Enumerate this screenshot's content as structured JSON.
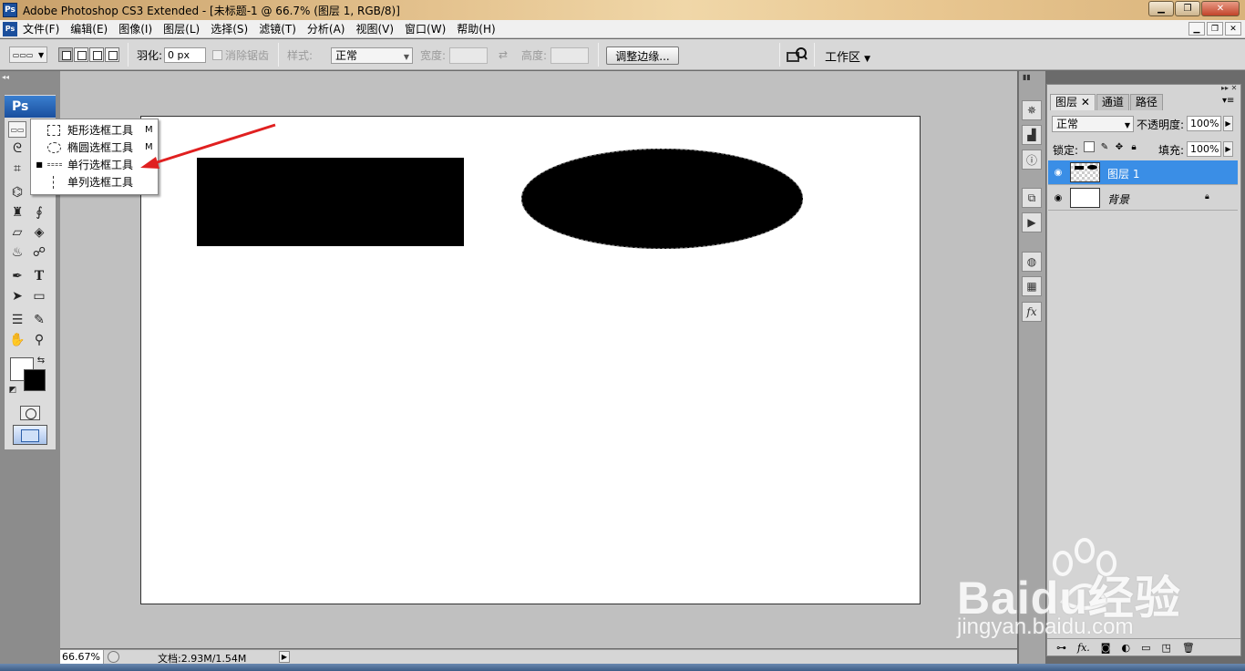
{
  "window": {
    "title": "Adobe Photoshop CS3 Extended - [未标题-1 @ 66.7% (图层 1, RGB/8)]",
    "app_icon": "Ps",
    "buttons": [
      "minimize-icon",
      "restore-icon",
      "close-icon"
    ]
  },
  "menubar": {
    "items": [
      "文件(F)",
      "编辑(E)",
      "图像(I)",
      "图层(L)",
      "选择(S)",
      "滤镜(T)",
      "分析(A)",
      "视图(V)",
      "窗口(W)",
      "帮助(H)"
    ]
  },
  "options": {
    "feather_label": "羽化:",
    "feather_value": "0 px",
    "antialias_label": "消除锯齿",
    "style_label": "样式:",
    "style_value": "正常",
    "width_label": "宽度:",
    "height_label": "高度:",
    "refine_edge": "调整边缘...",
    "workspace": "工作区"
  },
  "toolbox": {
    "logo": "Ps",
    "flyout": [
      {
        "label": "矩形选框工具",
        "key": "M",
        "icon": "rect-marquee-icon"
      },
      {
        "label": "椭圆选框工具",
        "key": "M",
        "icon": "ellipse-marquee-icon"
      },
      {
        "label": "单行选框工具",
        "key": "",
        "icon": "single-row-marquee-icon",
        "current": true
      },
      {
        "label": "单列选框工具",
        "key": "",
        "icon": "single-column-marquee-icon"
      }
    ],
    "foreground_color": "#000000",
    "background_color": "#ffffff"
  },
  "canvas": {
    "shapes": [
      {
        "type": "rectangle",
        "color": "#000000"
      },
      {
        "type": "ellipse",
        "color": "#000000"
      }
    ]
  },
  "layers_panel": {
    "tabs": [
      "图层",
      "通道",
      "路径"
    ],
    "blend_mode": "正常",
    "opacity_label": "不透明度:",
    "opacity_value": "100%",
    "lock_label": "锁定:",
    "fill_label": "填充:",
    "fill_value": "100%",
    "layers": [
      {
        "name": "图层 1",
        "selected": true,
        "locked": false
      },
      {
        "name": "背景",
        "selected": false,
        "locked": true
      }
    ],
    "bottom_icons": [
      "link-icon",
      "fx-icon",
      "mask-icon",
      "adjustment-icon",
      "folder-icon",
      "new-layer-icon",
      "trash-icon"
    ],
    "bottom_fx": "fx."
  },
  "status": {
    "zoom": "66.67%",
    "doc_info": "文档:2.93M/1.54M"
  },
  "watermark": {
    "brand": "Baidu经验",
    "url": "jingyan.baidu.com"
  },
  "colors": {
    "annotation_arrow": "#e02020",
    "selection_highlight": "#3a8ee6"
  }
}
